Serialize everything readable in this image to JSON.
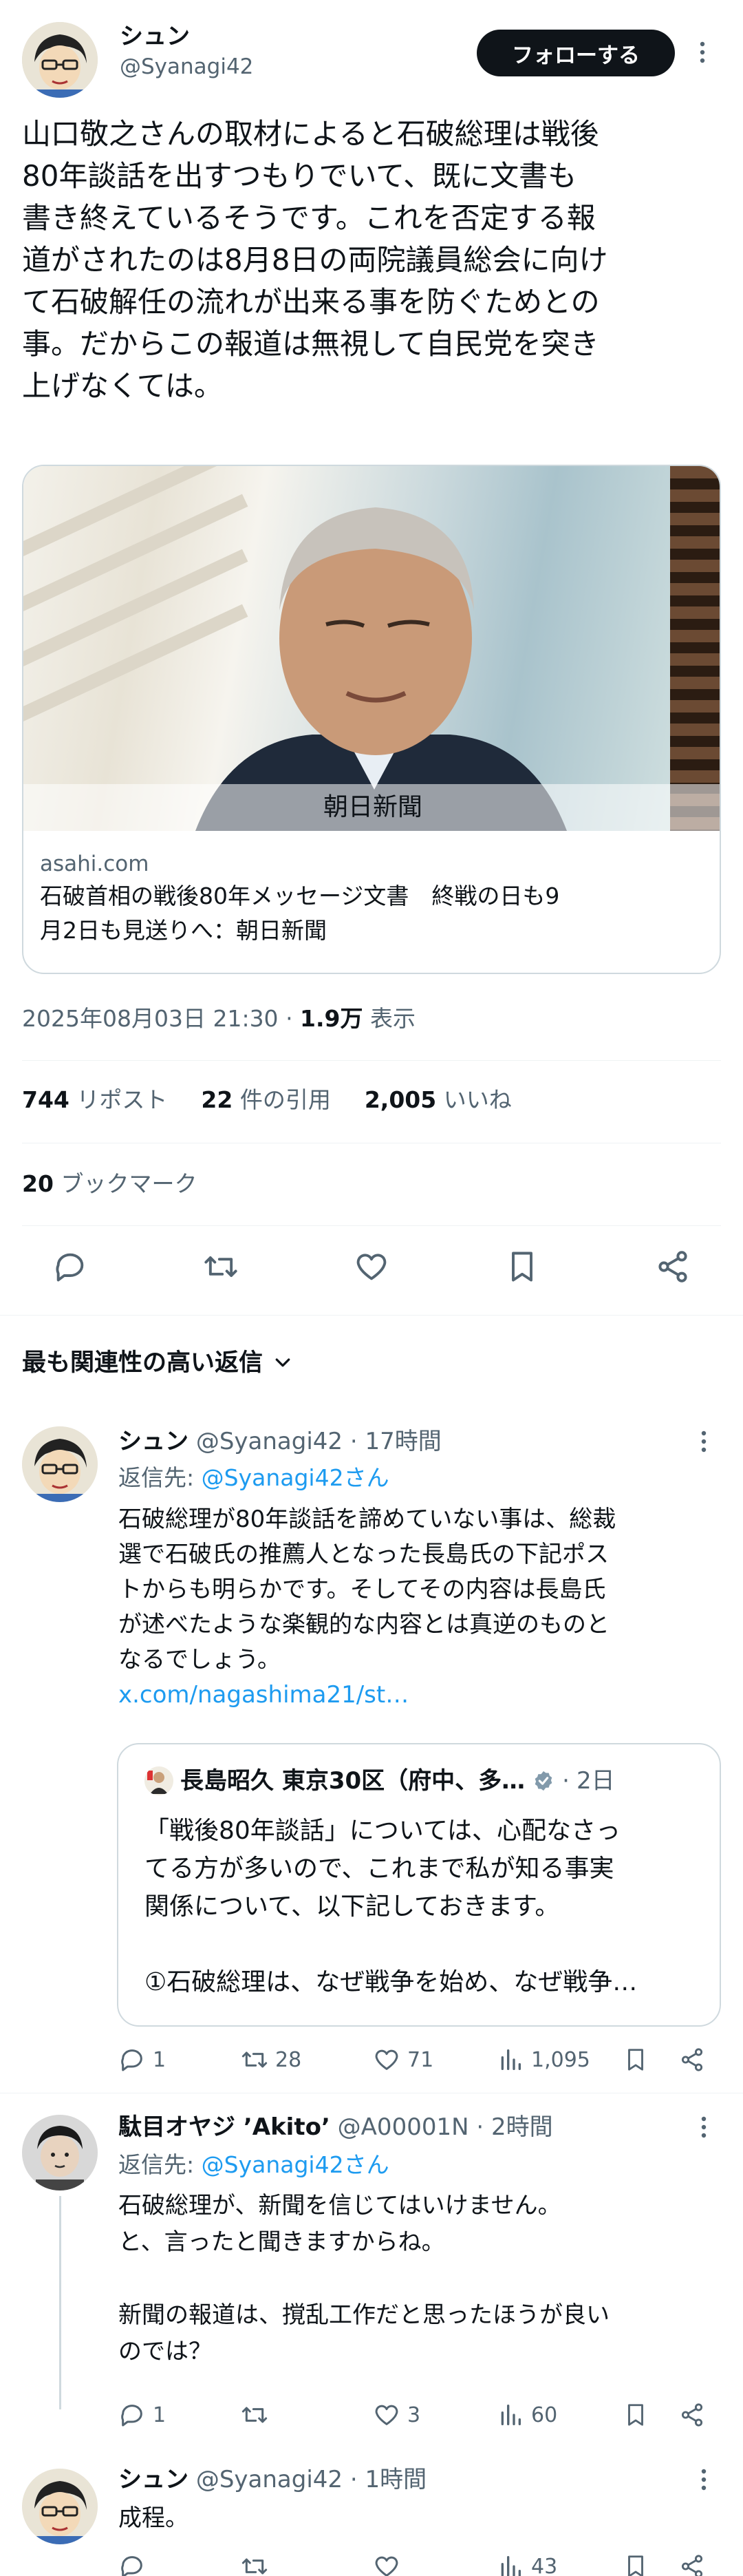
{
  "main_tweet": {
    "display_name": "シュン",
    "handle": "@Syanagi42",
    "follow_label": "フォローする",
    "text_lines": [
      "山口敬之さんの取材によると石破総理は戦後",
      "80年談話を出すつもりでいて、既に文書も",
      "書き終えているそうです。これを否定する報",
      "道がされたのは8月8日の両院議員総会に向け",
      "て石破解任の流れが出来る事を防ぐためとの",
      "事。だからこの報道は無視して自民党を突き",
      "上げなくては。"
    ],
    "card": {
      "image_caption": "朝日新聞",
      "domain": "asahi.com",
      "title_lines": [
        "石破首相の戦後80年メッセージ文書　終戦の日も9",
        "月2日も見送りへ：朝日新聞"
      ]
    },
    "timestamp": "2025年08月03日 21:30",
    "views_count": "1.9万",
    "views_label": "表示",
    "reposts_count": "744",
    "reposts_label": "リポスト",
    "quotes_count": "22",
    "quotes_label": "件の引用",
    "likes_count": "2,005",
    "likes_label": "いいね",
    "bookmarks_count": "20",
    "bookmarks_label": "ブックマーク"
  },
  "sort_label": "最も関連性の高い返信",
  "replies": [
    {
      "display_name": "シュン",
      "handle": "@Syanagi42",
      "time": "17時間",
      "reply_to_label": "返信先:",
      "reply_to_handle": "@Syanagi42さん",
      "text_lines": [
        "石破総理が80年談話を諦めていない事は、総裁",
        "選で石破氏の推薦人となった長島氏の下記ポス",
        "トからも明らかです。そしてその内容は長島氏",
        "が述べたような楽観的な内容とは真逆のものと",
        "なるでしょう。"
      ],
      "link": "x.com/nagashima21/st…",
      "quote": {
        "name": "長島昭久 東京30区（府中、多…",
        "time": "2日",
        "text_lines": [
          "「戦後80年談話」については、心配なさっ",
          "てる方が多いので、これまで私が知る事実",
          "関係について、以下記しておきます。",
          "",
          "①石破総理は、なぜ戦争を始め、なぜ戦争…"
        ]
      },
      "stats": {
        "replies": "1",
        "reposts": "28",
        "likes": "71",
        "views": "1,095"
      }
    },
    {
      "display_name": "駄目オヤジ ’Akito’",
      "handle": "@A00001N",
      "time": "2時間",
      "reply_to_label": "返信先:",
      "reply_to_handle": "@Syanagi42さん",
      "text_lines": [
        "石破総理が、新聞を信じてはいけません。",
        "と、言ったと聞きますからね。",
        "",
        "新聞の報道は、撹乱工作だと思ったほうが良い",
        "のでは？"
      ],
      "stats": {
        "replies": "1",
        "reposts": "",
        "likes": "3",
        "views": "60"
      }
    },
    {
      "display_name": "シュン",
      "handle": "@Syanagi42",
      "time": "1時間",
      "text_lines": [
        "成程。"
      ],
      "stats": {
        "replies": "",
        "reposts": "",
        "likes": "",
        "views": "43"
      }
    }
  ],
  "icons": {
    "more": "more-dots-icon",
    "reply": "reply-icon",
    "repost": "repost-icon",
    "like": "heart-icon",
    "bookmark": "bookmark-icon",
    "share": "share-icon",
    "views": "views-chart-icon",
    "verified": "verified-badge-icon",
    "chevron": "chevron-down-icon"
  },
  "colors": {
    "link": "#1d9bf0",
    "secondary": "#536471",
    "verified": "#829aab",
    "follow_bg": "#0f1419"
  }
}
